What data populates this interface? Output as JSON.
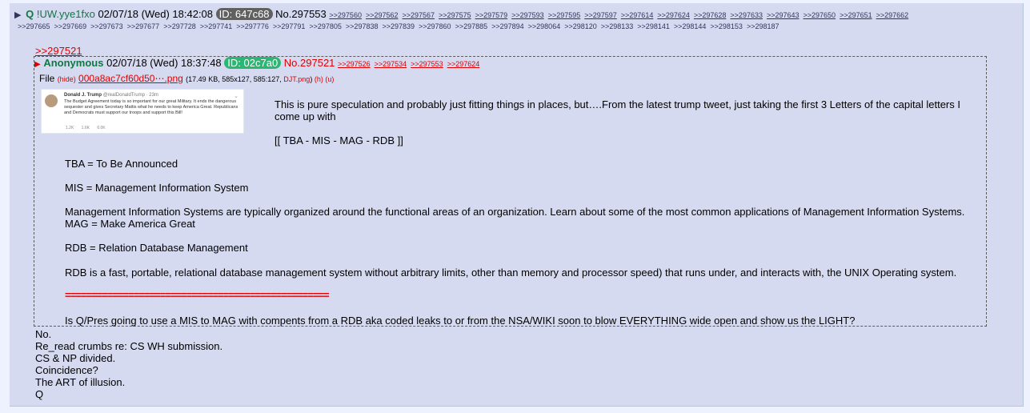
{
  "op": {
    "arrow": "▶",
    "name": "Q",
    "tripcode": "!UW.yye1fxo",
    "datetime": "02/07/18 (Wed) 18:42:08",
    "id_label": "ID: 647c68",
    "id_color": "#606060",
    "post_no": "No.297553",
    "backlinks_row1": [
      ">>297560",
      ">>297562",
      ">>297567",
      ">>297575",
      ">>297579",
      ">>297593",
      ">>297595",
      ">>297597",
      ">>297614",
      ">>297624",
      ">>297628",
      ">>297633",
      ">>297643",
      ">>297650",
      ">>297651",
      ">>297662"
    ],
    "backlinks_row2": [
      ">>297665",
      ">>297669",
      ">>297673",
      ">>297677",
      ">>297728",
      ">>297741",
      ">>297776",
      ">>297791",
      ">>297805",
      ">>297838",
      ">>297839",
      ">>297860",
      ">>297885",
      ">>297894",
      ">>298064",
      ">>298120",
      ">>298133",
      ">>298141",
      ">>298144",
      ">>298153",
      ">>298187"
    ],
    "quote_link": ">>297521",
    "text_lines": [
      "No.",
      "Re_read crumbs re: CS WH submission.",
      "CS & NP divided.",
      "Coincidence?",
      "The ART of illusion.",
      "Q"
    ]
  },
  "quoted": {
    "name": "Anonymous",
    "datetime": "02/07/18 (Wed) 18:37:48",
    "id_label": "ID: 02c7a0",
    "id_color": "#2bb673",
    "post_no": "No.297521",
    "backlinks": [
      ">>297526",
      ">>297534",
      ">>297553",
      ">>297624"
    ],
    "file_label": "File",
    "hide_label": "(hide)",
    "file_name": "000a8ac7cf60d50⋯.png",
    "file_meta": "(17.49 KB, 585x127, 585:127,",
    "file_orig": "DJT.png",
    "file_close": ")",
    "file_h": "(h)",
    "file_u": "(u)",
    "tweet": {
      "author": "Donald J. Trump",
      "handle": "@realDonaldTrump · 23m",
      "text": "The Budget Agreement today is so important for our great Military. It ends the dangerous sequester and gives Secretary Mattis what he needs to keep America Great. Republicans and Democrats must support our troops and support this Bill!",
      "stats": "1.2K 1.6K 6.0K"
    },
    "paragraphs": {
      "p1": "This is pure speculation and probably just fitting things in places, but….From the latest trump tweet, just taking the first 3 Letters of the capital letters I come up with",
      "p2": "[[ TBA - MIS - MAG - RDB ]]",
      "p3": "TBA = To Be Announced",
      "p4": "MIS = Management Information System",
      "p5": "Management Information Systems are typically organized around the functional areas of an organization. Learn about some of the most common applications of Management Information Systems.",
      "p6": "MAG = Make America Great",
      "p7": "RDB = Relation Database Management",
      "p8": "RDB is a fast, portable, relational database management system without arbitrary limits, other than memory and processor speed) that runs under, and interacts with, the UNIX Operating system.",
      "p9": "==================================================",
      "p10": "Is Q/Pres going to use a MIS to MAG with compents from a RDB aka coded leaks to or from the NSA/WIKI soon to blow EVERYTHING wide open and show us the LIGHT?"
    }
  }
}
